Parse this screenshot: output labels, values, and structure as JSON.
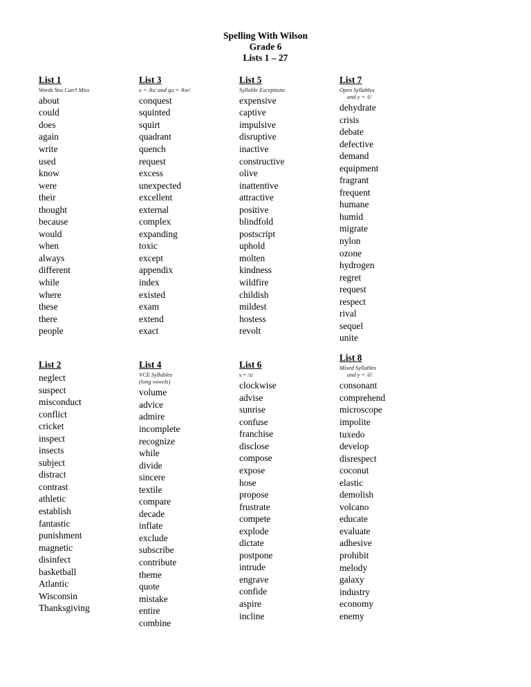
{
  "document": {
    "title_lines": [
      "Spelling With Wilson",
      "Grade 6",
      "Lists 1 – 27"
    ]
  },
  "lists": [
    {
      "heading": "List 1",
      "subtitle": "Words You Can’t Miss",
      "subtitle2": "",
      "words": [
        "about",
        "could",
        "does",
        "again",
        "write",
        "used",
        "know",
        "were",
        "their",
        "thought",
        "because",
        "would",
        "when",
        "always",
        "different",
        "while",
        "where",
        "these",
        "there",
        "people"
      ]
    },
    {
      "heading": "List 3",
      "subtitle": "x = /ks/ and qu = /kw/",
      "subtitle2": "",
      "words": [
        "conquest",
        "squinted",
        "squirt",
        "quadrant",
        "quench",
        "request",
        "excess",
        "unexpected",
        "excellent",
        "external",
        "complex",
        "expanding",
        "toxic",
        "except",
        "appendix",
        "index",
        "existed",
        "exam",
        "extend",
        "exact"
      ]
    },
    {
      "heading": "List 5",
      "subtitle": "Syllable Exceptions",
      "subtitle2": "",
      "words": [
        "expensive",
        "captive",
        "impulsive",
        "disruptive",
        "inactive",
        "constructive",
        "olive",
        "inattentive",
        "attractive",
        "positive",
        "blindfold",
        "postscript",
        "uphold",
        "molten",
        "kindness",
        "wildfire",
        "childish",
        "mildest",
        "hostess",
        "revolt"
      ]
    },
    {
      "heading": "List 7",
      "subtitle": "Open Syllables",
      "subtitle2": "and y = /ī/",
      "words": [
        "dehydrate",
        "crisis",
        "debate",
        "defective",
        "demand",
        "equipment",
        "fragrant",
        "frequent",
        "humane",
        "humid",
        "migrate",
        "nylon",
        "ozone",
        "hydrogen",
        "regret",
        "request",
        "respect",
        "rival",
        "sequel",
        "unite"
      ]
    },
    {
      "heading": "List 2",
      "subtitle": "",
      "subtitle2": "",
      "words": [
        "neglect",
        "suspect",
        "misconduct",
        "conflict",
        "cricket",
        "inspect",
        "insects",
        "subject",
        "distract",
        "contrast",
        "athletic",
        "establish",
        "fantastic",
        "punishment",
        "magnetic",
        "disinfect",
        "basketball",
        "Atlantic",
        "Wisconsin",
        "Thanksgiving"
      ]
    },
    {
      "heading": "List 4",
      "subtitle": "VCE Syllables",
      "subtitle2": "(long vowels)",
      "words": [
        "volume",
        "advice",
        "admire",
        "incomplete",
        "recognize",
        "while",
        "divide",
        "sincere",
        "textile",
        "compare",
        "decade",
        "inflate",
        "exclude",
        "subscribe",
        "contribute",
        "theme",
        "quote",
        "mistake",
        "entire",
        "combine"
      ]
    },
    {
      "heading": "List 6",
      "subtitle": "s = /z/",
      "subtitle2": "",
      "words": [
        "clockwise",
        "advise",
        "sunrise",
        "confuse",
        "franchise",
        "disclose",
        "compose",
        "expose",
        "hose",
        "propose",
        "frustrate",
        "compete",
        "explode",
        "dictate",
        "postpone",
        "intrude",
        "engrave",
        "confide",
        "aspire",
        "incline"
      ]
    },
    {
      "heading": "List 8",
      "subtitle": "Mixed Syllables",
      "subtitle2": "and y = /ē/",
      "words": [
        "consonant",
        "comprehend",
        "microscope",
        "impolite",
        "tuxedo",
        "develop",
        "disrespect",
        "coconut",
        "elastic",
        "demolish",
        "volcano",
        "educate",
        "evaluate",
        "adhesive",
        "prohibit",
        "melody",
        "galaxy",
        "industry",
        "economy",
        "enemy"
      ]
    }
  ]
}
